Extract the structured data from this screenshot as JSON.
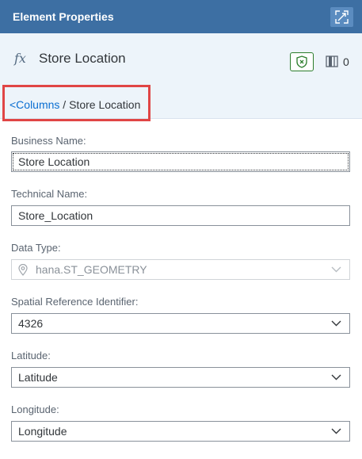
{
  "header": {
    "title": "Element Properties",
    "expand_icon": "expand-icon"
  },
  "object": {
    "icon": "fx",
    "title": "Store Location",
    "columns_count": "0"
  },
  "breadcrumb": {
    "link": "<Columns",
    "separator": " / ",
    "current": "Store Location"
  },
  "fields": {
    "business_name": {
      "label": "Business Name:",
      "value": "Store Location"
    },
    "technical_name": {
      "label": "Technical Name:",
      "value": "Store_Location"
    },
    "data_type": {
      "label": "Data Type:",
      "value": "hana.ST_GEOMETRY",
      "icon": "location-pin-icon"
    },
    "srid": {
      "label": "Spatial Reference Identifier:",
      "value": "4326"
    },
    "latitude": {
      "label": "Latitude:",
      "value": "Latitude"
    },
    "longitude": {
      "label": "Longitude:",
      "value": "Longitude"
    }
  },
  "colors": {
    "header_bg": "#3d6fa3",
    "subheader_bg": "#edf4fa",
    "link": "#0a6ed1",
    "highlight": "#e04545",
    "shield": "#2b7d2b"
  }
}
